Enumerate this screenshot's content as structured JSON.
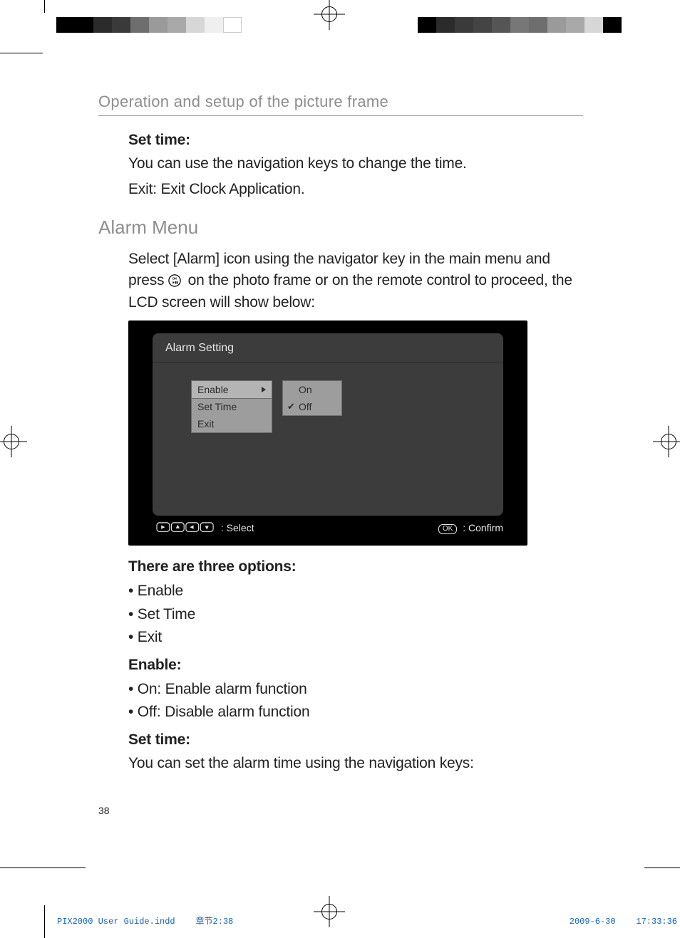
{
  "running_head": "Operation and setup of the picture frame",
  "set_time": {
    "heading": "Set time:",
    "line1": "You can use the navigation keys to change the time.",
    "line2": "Exit: Exit Clock Application."
  },
  "section_title": "Alarm Menu",
  "intro": {
    "pre_icon": "Select [Alarm] icon using the navigator key in the main menu and press ",
    "post_icon": " on the photo frame or on the remote control to proceed, the LCD screen will show below:"
  },
  "lcd": {
    "title": "Alarm Setting",
    "menu": {
      "items": [
        "Enable",
        "Set Time",
        "Exit"
      ],
      "selected_index": 0
    },
    "options": {
      "items": [
        "On",
        "Off"
      ],
      "checked_index": 1
    },
    "footer": {
      "select_label": ": Select",
      "confirm_label": ": Confirm",
      "ok_key": "OK"
    }
  },
  "after_lcd": {
    "options_heading": "There are three options:",
    "options_list": [
      "Enable",
      "Set Time",
      "Exit"
    ],
    "enable_heading": "Enable:",
    "enable_list": [
      "On: Enable alarm function",
      "Off: Disable alarm function"
    ],
    "settime_heading": "Set time:",
    "settime_text": "You can set the alarm time using the navigation keys:"
  },
  "page_number": "38",
  "slug": {
    "file": "PIX2000 User Guide.indd",
    "section": "章节2:38",
    "date": "2009-6-30",
    "time": "17:33:36"
  }
}
